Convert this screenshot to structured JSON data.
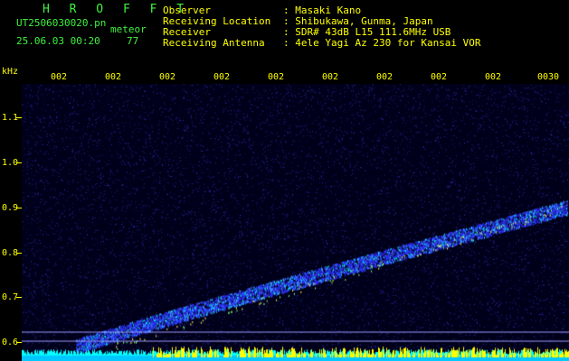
{
  "header": {
    "app_title": "H R O F F T",
    "filename": "UT2506030020.pn",
    "meteor_label": "meteor",
    "date_time": "25.06.03 00:20",
    "meteor_count": "77",
    "observer_label": "Observer",
    "observer_value": ": Masaki Kano",
    "location_label": "Receiving Location",
    "location_value": ": Shibukawa, Gunma, Japan",
    "receiver_label": "Receiver",
    "receiver_value": ": SDR# 43dB L15 111.6MHz USB",
    "antenna_label": "Receiving Antenna",
    "antenna_value": ": 4ele Yagi Az 230 for Kansai VOR"
  },
  "axis": {
    "unit": "kHz",
    "y_ticks": [
      "1.1",
      "1.0",
      "0.9",
      "0.8",
      "0.7",
      "0.6"
    ],
    "time_ticks": [
      "002",
      "002",
      "002",
      "002",
      "002",
      "002",
      "002",
      "002",
      "002",
      "0030"
    ]
  },
  "colors": {
    "text_green": "#3df33d",
    "text_yellow": "#ffff00",
    "background": "#000000",
    "spectrum_bg": "#00001a",
    "signal_cyan": "#00ffff",
    "signal_blue": "#1a1aff"
  },
  "spectrogram": {
    "trace_start_khz": 0.59,
    "trace_end_khz": 0.9,
    "baseline_khz": 0.605
  }
}
